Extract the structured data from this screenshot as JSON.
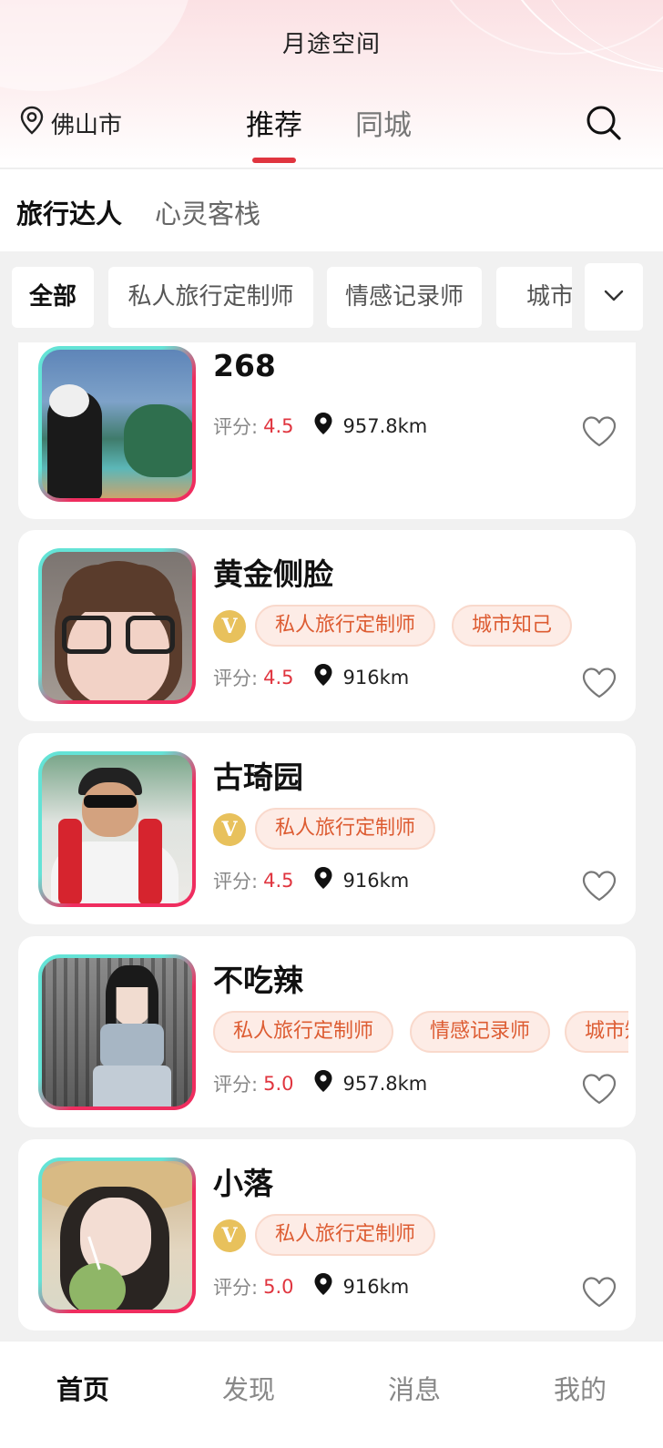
{
  "header": {
    "title": "月途空间",
    "location": "佛山市",
    "tabs": [
      {
        "label": "推荐",
        "active": true
      },
      {
        "label": "同城",
        "active": false
      }
    ],
    "accent_color": "#e0353f"
  },
  "subtabs": [
    {
      "label": "旅行达人",
      "active": true
    },
    {
      "label": "心灵客栈",
      "active": false
    }
  ],
  "filters": {
    "chips": [
      {
        "label": "全部",
        "active": true
      },
      {
        "label": "私人旅行定制师",
        "active": false
      },
      {
        "label": "情感记录师",
        "active": false
      },
      {
        "label": "城市知己",
        "active": false
      }
    ],
    "more_icon": "chevron-down-icon"
  },
  "cards": [
    {
      "name": "268",
      "vip": false,
      "tags": [],
      "score_label": "评分:",
      "score": "4.5",
      "distance": "957.8km"
    },
    {
      "name": "黄金侧脸",
      "vip": true,
      "vip_label": "V",
      "tags": [
        "私人旅行定制师",
        "城市知己"
      ],
      "score_label": "评分:",
      "score": "4.5",
      "distance": "916km"
    },
    {
      "name": "古琦园",
      "vip": true,
      "vip_label": "V",
      "tags": [
        "私人旅行定制师"
      ],
      "score_label": "评分:",
      "score": "4.5",
      "distance": "916km"
    },
    {
      "name": "不吃辣",
      "vip": false,
      "tags": [
        "私人旅行定制师",
        "情感记录师",
        "城市知己"
      ],
      "score_label": "评分:",
      "score": "5.0",
      "distance": "957.8km"
    },
    {
      "name": "小落",
      "vip": true,
      "vip_label": "V",
      "tags": [
        "私人旅行定制师"
      ],
      "score_label": "评分:",
      "score": "5.0",
      "distance": "916km"
    }
  ],
  "bottom_nav": [
    {
      "label": "首页",
      "active": true
    },
    {
      "label": "发现",
      "active": false
    },
    {
      "label": "消息",
      "active": false
    },
    {
      "label": "我的",
      "active": false
    }
  ]
}
